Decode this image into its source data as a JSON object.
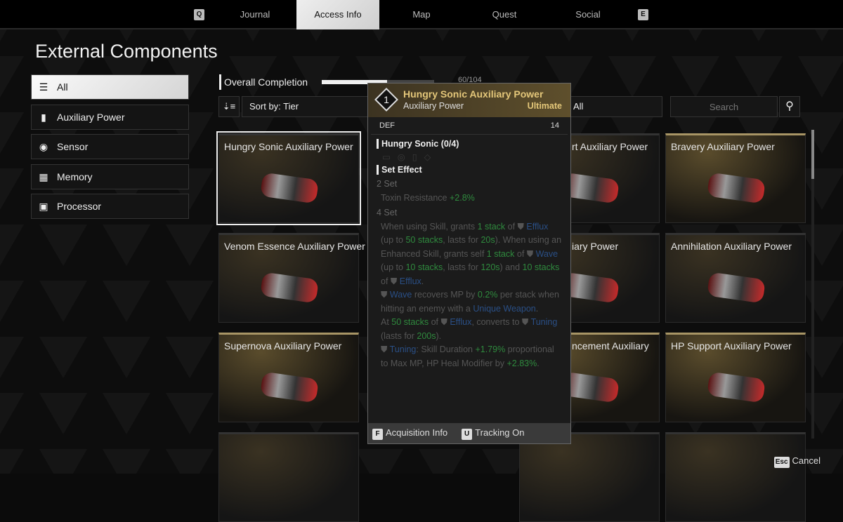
{
  "tabs": {
    "left_key": "Q",
    "right_key": "E",
    "items": [
      "Journal",
      "Access Info",
      "Map",
      "Quest",
      "Social"
    ],
    "active": "Access Info"
  },
  "page_title": "External Components",
  "sidebar": [
    {
      "label": "All",
      "icon": "layers-icon",
      "active": true
    },
    {
      "label": "Auxiliary Power",
      "icon": "battery-icon"
    },
    {
      "label": "Sensor",
      "icon": "sensor-icon"
    },
    {
      "label": "Memory",
      "icon": "memory-chip-icon"
    },
    {
      "label": "Processor",
      "icon": "processor-icon"
    }
  ],
  "completion": {
    "label": "Overall Completion",
    "value": "60/104",
    "progress": 0.58
  },
  "controls": {
    "sort_label": "Sort by: Tier",
    "filter_label": "All",
    "search_placeholder": "Search"
  },
  "cards": [
    {
      "name": "Hungry Sonic Auxiliary Power",
      "selected": true
    },
    {
      "name": "rt Auxiliary Power"
    },
    {
      "name": "Bravery Auxiliary Power",
      "gold": true
    },
    {
      "name": "Venom Essence Auxiliary Power"
    },
    {
      "name": "iary Power"
    },
    {
      "name": "Annihilation Auxiliary Power"
    },
    {
      "name": "Supernova Auxiliary Power",
      "gold": true
    },
    {
      "name": "ncement Auxiliary",
      "gold": true
    },
    {
      "name": "HP Support Auxiliary Power",
      "gold": true
    }
  ],
  "tooltip": {
    "tier": "1",
    "name": "Hungry Sonic Auxiliary Power",
    "type": "Auxiliary Power",
    "rarity": "Ultimate",
    "stat_name": "DEF",
    "stat_value": "14",
    "set_name": "Hungry Sonic (0/4)",
    "set_effect_label": "Set Effect",
    "set2_label": "2 Set",
    "set2_text": "Toxin Resistance",
    "set2_value": "+2.8%",
    "set4_label": "4 Set",
    "footer": [
      {
        "key": "F",
        "label": "Acquisition Info"
      },
      {
        "key": "U",
        "label": "Tracking On"
      }
    ]
  },
  "cancel": {
    "key": "Esc",
    "label": "Cancel"
  },
  "colors": {
    "gold": "#e4c77a",
    "green": "#2f8a3e",
    "blue": "#2a4f86"
  }
}
